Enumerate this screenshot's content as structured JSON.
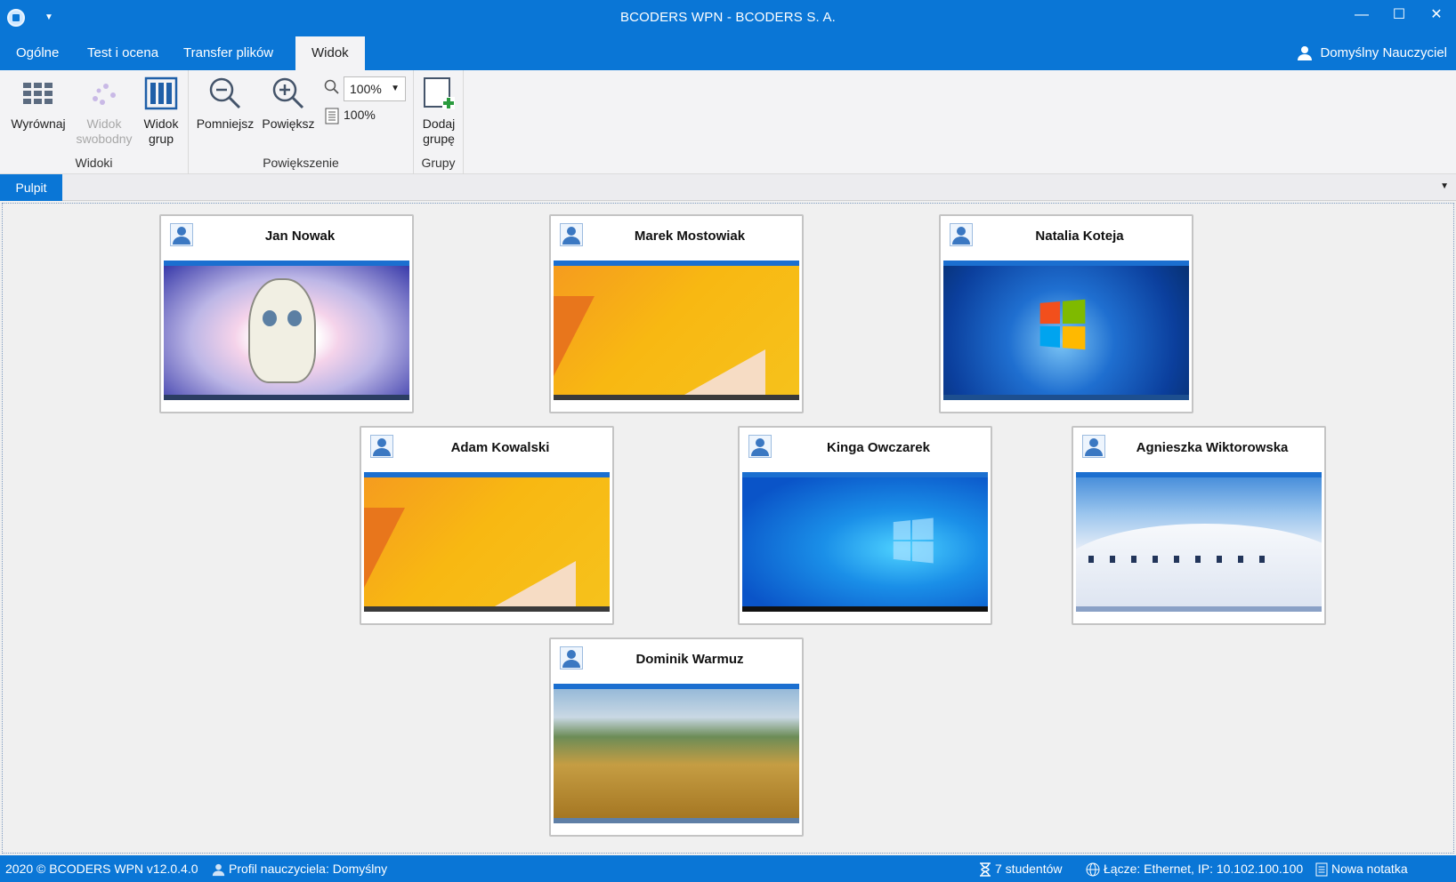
{
  "window": {
    "title": "BCODERS WPN - BCODERS S. A."
  },
  "ribbon": {
    "tabs": [
      {
        "label": "Ogólne"
      },
      {
        "label": "Test i ocena"
      },
      {
        "label": "Transfer plików"
      },
      {
        "label": "Widok",
        "active": true
      }
    ],
    "user": "Domyślny Nauczyciel",
    "groups": {
      "views": {
        "label": "Widoki",
        "align": "Wyrównaj",
        "free_line1": "Widok",
        "free_line2": "swobodny",
        "groups_line1": "Widok",
        "groups_line2": "grup"
      },
      "zoom": {
        "label": "Powiększenie",
        "zoom_out": "Pomniejsz",
        "zoom_in": "Powiększ",
        "zoom_value": "100%",
        "page_zoom": "100%"
      },
      "group": {
        "label": "Grupy",
        "add_line1": "Dodaj",
        "add_line2": "grupę"
      }
    }
  },
  "desktop_tab": "Pulpit",
  "students": [
    {
      "name": "Jan Nowak",
      "wallpaper": "anime"
    },
    {
      "name": "Marek Mostowiak",
      "wallpaper": "orange"
    },
    {
      "name": "Natalia Koteja",
      "wallpaper": "win7"
    },
    {
      "name": "Adam Kowalski",
      "wallpaper": "orange"
    },
    {
      "name": "Kinga Owczarek",
      "wallpaper": "win10"
    },
    {
      "name": "Agnieszka Wiktorowska",
      "wallpaper": "architecture"
    },
    {
      "name": "Dominik Warmuz",
      "wallpaper": "field"
    }
  ],
  "status": {
    "copyright": "2020 ©  BCODERS WPN v12.0.4.0",
    "profile": "Profil nauczyciela: Domyślny",
    "students_count": "7 studentów",
    "connection": "Łącze: Ethernet, IP: 10.102.100.100",
    "note": "Nowa notatka"
  },
  "colors": {
    "accent": "#0a76d6",
    "ribbon_bg": "#f3f3f5"
  }
}
